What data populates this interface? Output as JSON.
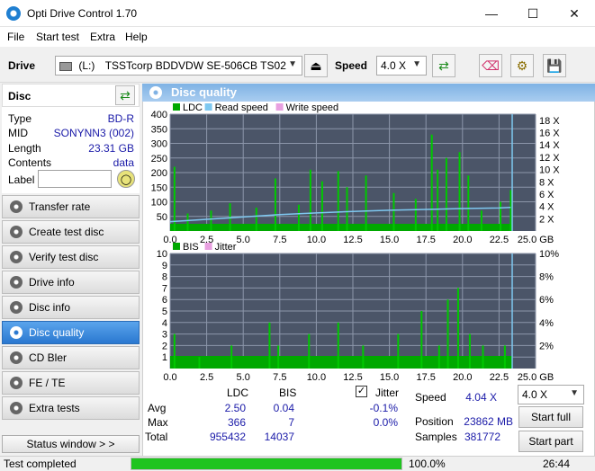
{
  "window": {
    "title": "Opti Drive Control 1.70",
    "controls": [
      "—",
      "☐",
      "✕"
    ]
  },
  "menu": [
    "File",
    "Start test",
    "Extra",
    "Help"
  ],
  "toolbar": {
    "drive_label": "Drive",
    "drive_letter": "(L:)",
    "drive_name": "TSSTcorp BDDVDW SE-506CB TS02",
    "speed_label": "Speed",
    "speed_value": "4.0 X"
  },
  "disc": {
    "header": "Disc",
    "rows": [
      {
        "label": "Type",
        "value": "BD-R"
      },
      {
        "label": "MID",
        "value": "SONYNN3 (002)"
      },
      {
        "label": "Length",
        "value": "23.31 GB"
      },
      {
        "label": "Contents",
        "value": "data"
      }
    ],
    "label_field": "Label",
    "label_value": ""
  },
  "nav": [
    {
      "label": "Transfer rate",
      "active": false
    },
    {
      "label": "Create test disc",
      "active": false
    },
    {
      "label": "Verify test disc",
      "active": false
    },
    {
      "label": "Drive info",
      "active": false
    },
    {
      "label": "Disc info",
      "active": false
    },
    {
      "label": "Disc quality",
      "active": true
    },
    {
      "label": "CD Bler",
      "active": false
    },
    {
      "label": "FE / TE",
      "active": false
    },
    {
      "label": "Extra tests",
      "active": false
    }
  ],
  "status_window_button": "Status window > >",
  "panel_title": "Disc quality",
  "chart_data": [
    {
      "type": "area",
      "legend": [
        "LDC",
        "Read speed",
        "Write speed"
      ],
      "x_ticks": [
        "0.0",
        "2.5",
        "5.0",
        "7.5",
        "10.0",
        "12.5",
        "15.0",
        "17.5",
        "20.0",
        "22.5",
        "25.0 GB"
      ],
      "y_ticks_left": [
        "400",
        "350",
        "300",
        "250",
        "200",
        "150",
        "100",
        "50"
      ],
      "y_ticks_right": [
        "18 X",
        "16 X",
        "14 X",
        "12 X",
        "10 X",
        "8 X",
        "6 X",
        "4 X",
        "2 X"
      ],
      "xlim": [
        0,
        25
      ],
      "ylim": [
        0,
        400
      ],
      "data_end_gb": 23.4,
      "series": [
        {
          "name": "LDC",
          "color": "#00c800",
          "x": [
            0.3,
            1.2,
            2.8,
            4.1,
            5.9,
            7.2,
            8.8,
            9.6,
            10.4,
            11.5,
            12.1,
            13.4,
            15.3,
            16.8,
            17.9,
            18.3,
            18.9,
            19.8,
            20.4,
            21.3,
            22.6,
            23.3
          ],
          "y": [
            220,
            60,
            70,
            95,
            80,
            180,
            90,
            210,
            170,
            205,
            150,
            190,
            130,
            110,
            330,
            210,
            250,
            270,
            190,
            70,
            100,
            140
          ]
        },
        {
          "name": "Read speed",
          "color": "#7ec8f0",
          "x": [
            0.0,
            2.5,
            5.0,
            7.5,
            10.0,
            12.5,
            15.0,
            17.5,
            20.0,
            22.5,
            23.3
          ],
          "y": [
            1.6,
            2.0,
            2.4,
            2.8,
            3.1,
            3.35,
            3.55,
            3.7,
            3.85,
            3.95,
            4.04
          ]
        }
      ]
    },
    {
      "type": "area",
      "legend": [
        "BIS",
        "Jitter"
      ],
      "x_ticks": [
        "0.0",
        "2.5",
        "5.0",
        "7.5",
        "10.0",
        "12.5",
        "15.0",
        "17.5",
        "20.0",
        "22.5",
        "25.0 GB"
      ],
      "y_ticks_left": [
        "10",
        "9",
        "8",
        "7",
        "6",
        "5",
        "4",
        "3",
        "2",
        "1"
      ],
      "y_ticks_right": [
        "10%",
        "8%",
        "6%",
        "4%",
        "2%"
      ],
      "xlim": [
        0,
        25
      ],
      "ylim": [
        0,
        10
      ],
      "data_end_gb": 23.4,
      "series": [
        {
          "name": "BIS",
          "color": "#00c800",
          "x": [
            0.3,
            2.0,
            4.2,
            6.8,
            7.4,
            9.5,
            11.5,
            13.2,
            15.6,
            17.2,
            18.4,
            19.0,
            19.7,
            20.5,
            21.4,
            22.9
          ],
          "y": [
            3,
            1,
            2,
            4,
            2,
            3,
            4,
            2,
            3,
            5,
            2,
            6,
            7,
            3,
            2,
            2
          ]
        }
      ]
    }
  ],
  "stats": {
    "headers": [
      "LDC",
      "BIS"
    ],
    "jitter_label": "Jitter",
    "jitter_checked": true,
    "rows": [
      {
        "label": "Avg",
        "ldc": "2.50",
        "bis": "0.04",
        "jitter": "-0.1%"
      },
      {
        "label": "Max",
        "ldc": "366",
        "bis": "7",
        "jitter": "0.0%"
      },
      {
        "label": "Total",
        "ldc": "955432",
        "bis": "14037",
        "jitter": ""
      }
    ],
    "speed_label": "Speed",
    "speed_value": "4.04 X",
    "position_label": "Position",
    "position_value": "23862 MB",
    "samples_label": "Samples",
    "samples_value": "381772",
    "speed_select": "4.0 X",
    "start_full": "Start full",
    "start_part": "Start part"
  },
  "status": {
    "text": "Test completed",
    "progress": 1.0,
    "progress_text": "100.0%",
    "time": "26:44"
  },
  "colors": {
    "chart_bg": "#4b5568",
    "grid": "#8c96aa",
    "ldc": "#00c800",
    "read_speed": "#7ec8f0",
    "accent": "#2a78d0",
    "progress": "#1fc41f"
  }
}
